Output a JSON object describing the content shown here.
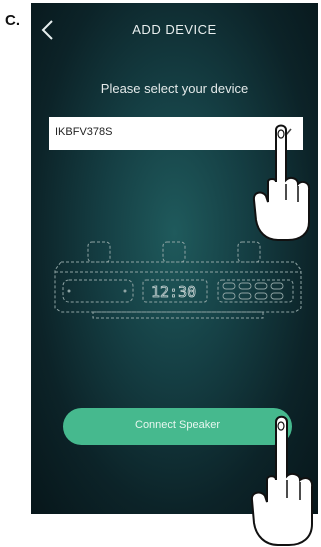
{
  "step_label": "C.",
  "header": {
    "title": "ADD DEVICE"
  },
  "main": {
    "prompt": "Please select your device",
    "device_select": {
      "value": "IKBFV378S"
    },
    "connect_button": {
      "label": "Connect Speaker"
    }
  },
  "icons": {
    "back": "chevron-left-icon",
    "dropdown": "chevron-down-icon",
    "pointer": "pointing-hand"
  },
  "colors": {
    "background_center": "#1f5a5c",
    "background_edge": "#07161a",
    "connect_button": "#46b98e",
    "select_background": "#ffffff"
  }
}
